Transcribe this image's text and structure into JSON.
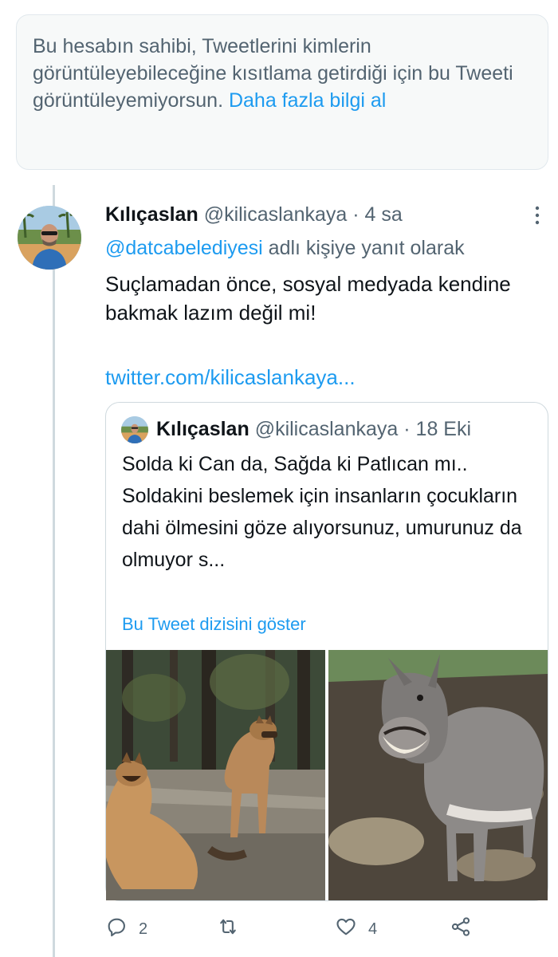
{
  "notice": {
    "text": "Bu hesabın sahibi, Tweetlerini kimlerin görüntüleyebileceğine kısıtlama getirdiği için bu Tweeti görüntüleyemiyorsun.",
    "link": "Daha fazla bilgi al"
  },
  "tweet": {
    "name": "Kılıçaslan",
    "handle": "@kilicaslankaya",
    "sep": "·",
    "time": "4 sa",
    "more_icon": "more-vertical-icon",
    "reply_mention": "@datcabelediyesi",
    "reply_suffix": "adlı kişiye yanıt olarak",
    "text": "Suçlamadan önce, sosyal medyada kendine bakmak lazım değil mi!",
    "link": "twitter.com/kilicaslankaya..."
  },
  "quote": {
    "name": "Kılıçaslan",
    "handle": "@kilicaslankaya",
    "sep": "·",
    "time": "18 Eki",
    "line1": "Solda ki Can da, Sağda ki Patlıcan mı..",
    "line2": "Soldakini beslemek için insanların çocukların dahi ölmesini göze alıyorsunuz, umurunuz da olmuyor s...",
    "thread_link": "Bu Tweet dizisini göster",
    "photos": [
      "stray-dogs-photo",
      "donkey-photo"
    ]
  },
  "actions": {
    "reply": {
      "icon": "reply-icon",
      "count": "2"
    },
    "retweet": {
      "icon": "retweet-icon",
      "count": ""
    },
    "like": {
      "icon": "heart-icon",
      "count": "4"
    },
    "share": {
      "icon": "share-icon",
      "count": ""
    }
  },
  "colors": {
    "accent": "#1d9bf0",
    "secondary_text": "#536471",
    "primary_text": "#0f1419",
    "notice_bg": "#f7f9f9"
  }
}
